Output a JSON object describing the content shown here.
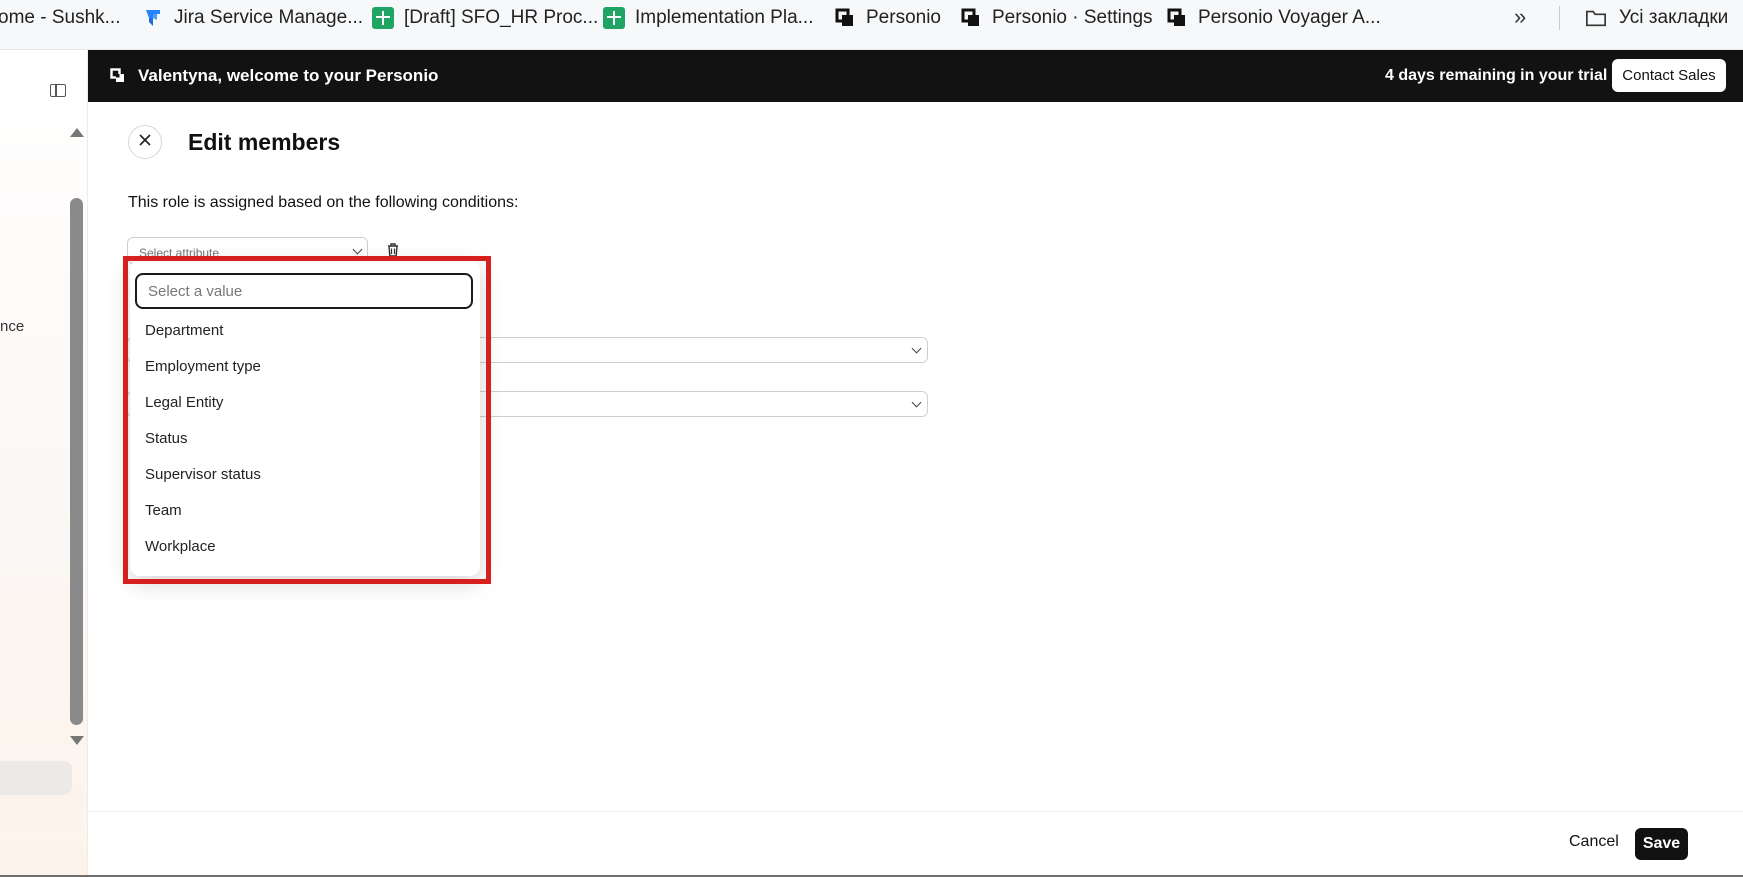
{
  "bookmarks": {
    "items": [
      {
        "label": "ome - Sushk...",
        "icon": "none"
      },
      {
        "label": "Jira Service Manage...",
        "icon": "jira-icon"
      },
      {
        "label": "[Draft] SFO_HR Proc...",
        "icon": "google-sheets-icon"
      },
      {
        "label": "Implementation Pla...",
        "icon": "google-sheets-icon"
      },
      {
        "label": "Personio",
        "icon": "personio-icon"
      },
      {
        "label": "Personio · Settings",
        "icon": "personio-icon"
      },
      {
        "label": "Personio Voyager A...",
        "icon": "personio-icon"
      }
    ],
    "more": "»",
    "all_bookmarks": "Усі закладки"
  },
  "sidebar": {
    "partial_text": "nce"
  },
  "banner": {
    "title": "Valentyna, welcome to your Personio",
    "trial": "4 days remaining in your trial",
    "contact_label": "Contact Sales"
  },
  "page": {
    "title": "Edit members",
    "conditions_text": "This role is assigned based on the following conditions:",
    "attribute_placeholder": "Select attribute"
  },
  "dropdown": {
    "search_placeholder": "Select a value",
    "options": [
      "Department",
      "Employment type",
      "Legal Entity",
      "Status",
      "Supervisor status",
      "Team",
      "Workplace"
    ]
  },
  "footer": {
    "cancel_label": "Cancel",
    "save_label": "Save"
  },
  "colors": {
    "banner_bg": "#121212",
    "highlight": "#d62020",
    "sheets_green": "#1fa463",
    "jira_blue": "#2684ff"
  }
}
